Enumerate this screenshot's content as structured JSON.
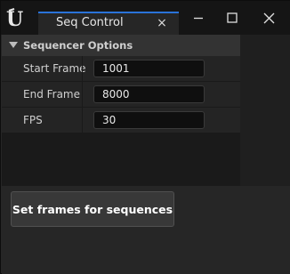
{
  "window": {
    "tab_title": "Seq Control",
    "tab_close_glyph": "×",
    "accent_color": "#2a73d9",
    "controls": [
      "minimize-icon",
      "maximize-icon",
      "close-icon"
    ]
  },
  "section": {
    "title": "Sequencer Options",
    "expanded": true
  },
  "fields": [
    {
      "label": "Start Frame",
      "value": "1001"
    },
    {
      "label": "End Frame",
      "value": "8000"
    },
    {
      "label": "FPS",
      "value": "30"
    }
  ],
  "actions": {
    "set_frames_label": "Set frames for sequences"
  }
}
